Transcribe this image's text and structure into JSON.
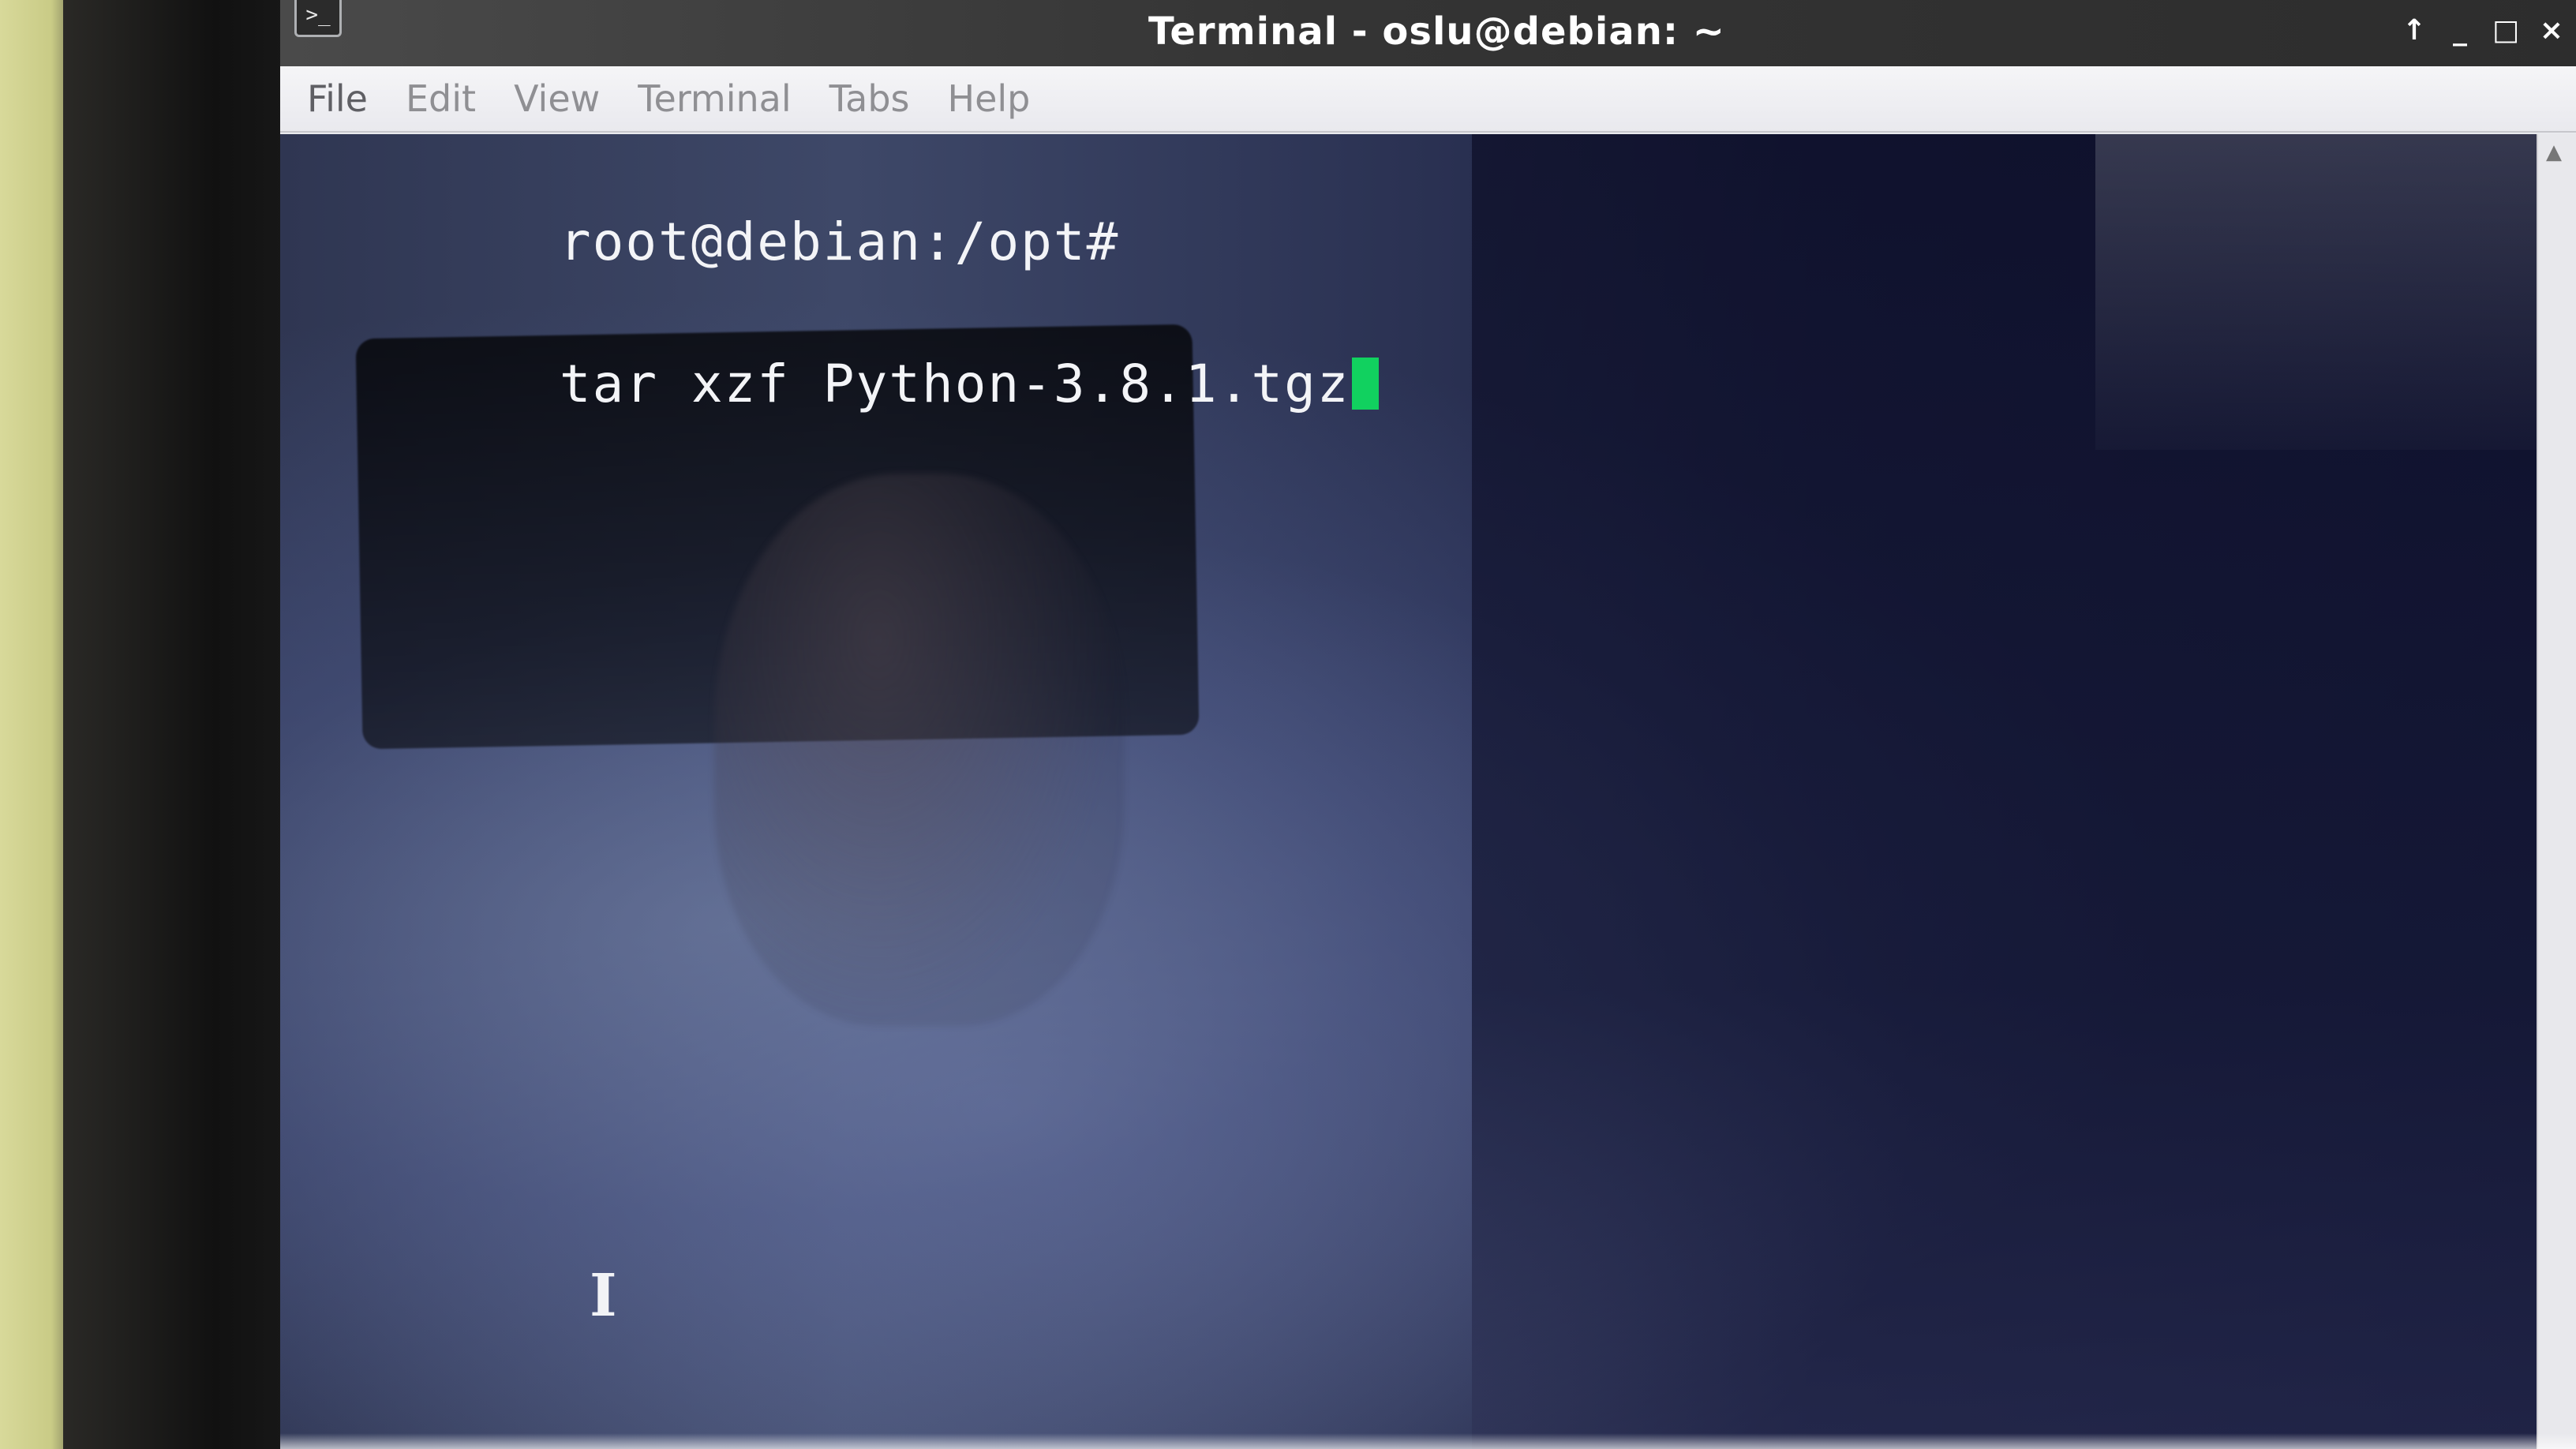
{
  "window": {
    "title": "Terminal - oslu@debian: ~",
    "app_icon": "terminal-icon",
    "controls": {
      "pin": "↑",
      "minimize": "_",
      "maximize": "□",
      "close": "×"
    }
  },
  "menu": {
    "items": [
      "File",
      "Edit",
      "View",
      "Terminal",
      "Tabs",
      "Help"
    ]
  },
  "terminal": {
    "prompt": "root@debian:/opt#",
    "command": "tar xzf Python-3.8.1.tgz",
    "cursor_color": "#11d15f",
    "text_cursor": "I"
  },
  "scrollbar": {
    "up_arrow": "▲"
  }
}
